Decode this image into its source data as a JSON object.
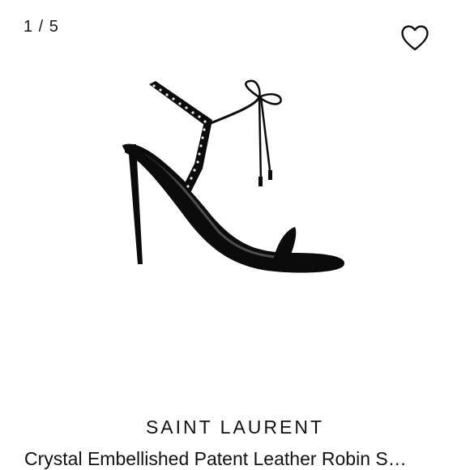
{
  "gallery": {
    "counter": "1 / 5"
  },
  "product": {
    "brand": "SAINT LAURENT",
    "title": "Crystal Embellished Patent Leather Robin S…"
  },
  "icons": {
    "wishlist": "heart-outline-icon"
  },
  "colors": {
    "background": "#ffffff",
    "text": "#111111",
    "shoe": "#0b0b0b"
  }
}
